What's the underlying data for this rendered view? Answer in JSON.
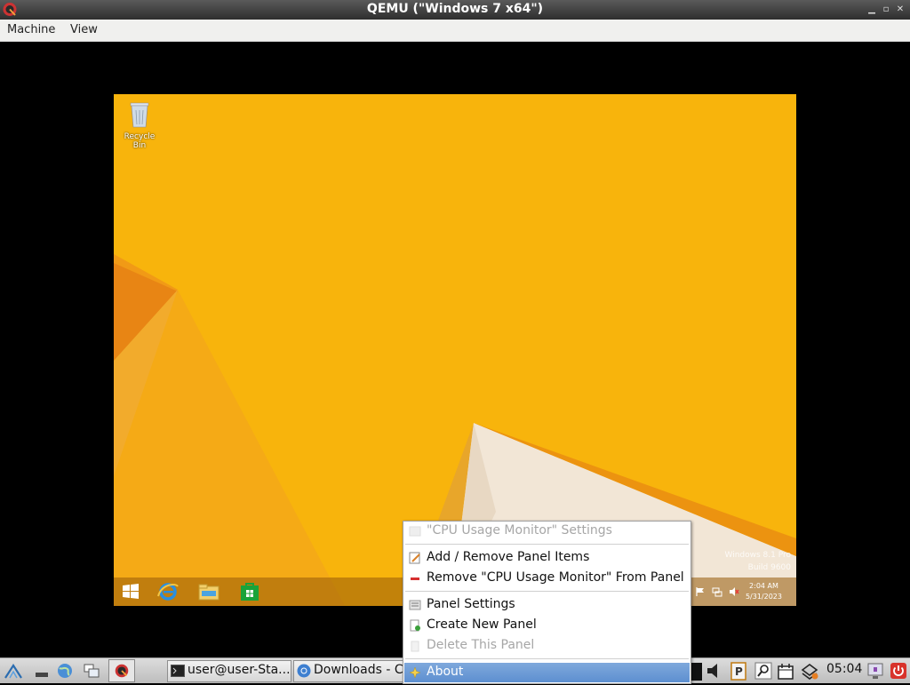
{
  "window": {
    "title": "QEMU (\"Windows 7 x64\")"
  },
  "menubar": {
    "items": [
      "Machine",
      "View"
    ]
  },
  "guest": {
    "recycle_bin_label": "Recycle Bin",
    "watermark_line1": "Windows 8.1 Pro",
    "watermark_line2": "Build 9600",
    "clock_time": "2:04 AM",
    "clock_date": "5/31/2023"
  },
  "context_menu": {
    "items": [
      {
        "label": "\"CPU Usage Monitor\" Settings",
        "enabled": false
      },
      {
        "label": "Add / Remove Panel Items",
        "enabled": true
      },
      {
        "label": "Remove \"CPU Usage Monitor\" From Panel",
        "enabled": true
      },
      {
        "label": "Panel Settings",
        "enabled": true
      },
      {
        "label": "Create New Panel",
        "enabled": true
      },
      {
        "label": "Delete This Panel",
        "enabled": false
      },
      {
        "label": "About",
        "enabled": true,
        "selected": true
      }
    ]
  },
  "panel": {
    "tasks": [
      {
        "label": "user@user-Sta..."
      },
      {
        "label": "Downloads - C..."
      }
    ],
    "clock": "05:04"
  },
  "colors": {
    "guest_bg": "#f7b30b",
    "selection": "#6b9ad6",
    "panel": "#cfcfcf"
  }
}
